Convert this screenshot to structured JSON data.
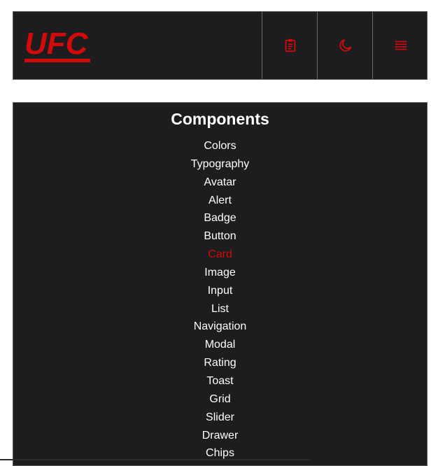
{
  "header": {
    "logo_text": "UFC",
    "buttons": [
      {
        "icon": "clipboard-icon"
      },
      {
        "icon": "moon-icon"
      },
      {
        "icon": "menu-icon"
      }
    ]
  },
  "sidebar": {
    "title": "Components",
    "items": [
      {
        "label": "Colors"
      },
      {
        "label": "Typography"
      },
      {
        "label": "Avatar"
      },
      {
        "label": "Alert"
      },
      {
        "label": "Badge"
      },
      {
        "label": "Button"
      },
      {
        "label": "Card",
        "active": true
      },
      {
        "label": "Image"
      },
      {
        "label": "Input"
      },
      {
        "label": "List"
      },
      {
        "label": "Navigation"
      },
      {
        "label": "Modal"
      },
      {
        "label": "Rating"
      },
      {
        "label": "Toast"
      },
      {
        "label": "Grid"
      },
      {
        "label": "Slider"
      },
      {
        "label": "Drawer"
      },
      {
        "label": "Chips"
      }
    ]
  },
  "colors": {
    "brand_red": "#d20a0a",
    "surface": "#1d1c1e",
    "text": "#ffffff"
  }
}
